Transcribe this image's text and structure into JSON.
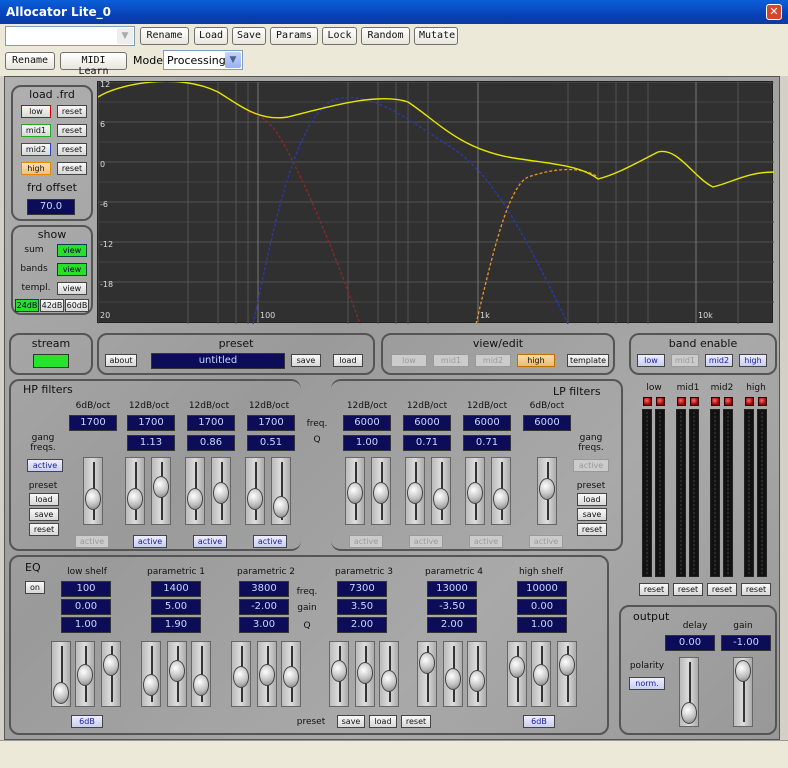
{
  "window": {
    "title": "Allocator Lite_0",
    "close_icon": "close-icon"
  },
  "toolbar": {
    "preset_combo_value": "",
    "row1_buttons": [
      "Rename",
      "Load",
      "Save",
      "Params",
      "Lock",
      "Random",
      "Mutate"
    ],
    "row2_rename": "Rename",
    "row2_midi": "MIDI Learn",
    "mode_label": "Mode",
    "mode_value": "Processing"
  },
  "load_frd": {
    "title": "load .frd",
    "bands": [
      "low",
      "mid1",
      "mid2",
      "high"
    ],
    "reset": "reset",
    "offset_label": "frd offset",
    "offset_value": "70.0"
  },
  "show": {
    "title": "show",
    "rows": [
      {
        "label": "sum",
        "btn": "view"
      },
      {
        "label": "bands",
        "btn": "view"
      },
      {
        "label": "templ.",
        "btn": "view"
      }
    ],
    "ranges": [
      "24dB",
      "42dB",
      "60dB"
    ]
  },
  "graph": {
    "y_ticks": [
      "12",
      "6",
      "0",
      "-6",
      "-12",
      "-18"
    ],
    "x_ticks": [
      "20",
      "100",
      "1k",
      "10k"
    ]
  },
  "stream": {
    "title": "stream"
  },
  "preset": {
    "title": "preset",
    "about": "about",
    "name": "untitled",
    "save": "save",
    "load": "load"
  },
  "view_edit": {
    "title": "view/edit",
    "bands": [
      "low",
      "mid1",
      "mid2",
      "high"
    ],
    "template": "template"
  },
  "band_enable": {
    "title": "band enable",
    "bands": [
      "low",
      "mid1",
      "mid2",
      "high"
    ]
  },
  "hp": {
    "title": "HP filters",
    "slopes": [
      "6dB/oct",
      "12dB/oct",
      "12dB/oct",
      "12dB/oct"
    ],
    "freqs": [
      "1700",
      "1700",
      "1700",
      "1700"
    ],
    "qs": [
      "1.13",
      "0.86",
      "0.51"
    ],
    "active": "active",
    "gang": "gang freqs.",
    "preset": "preset",
    "load": "load",
    "save": "save",
    "reset": "reset"
  },
  "lp": {
    "title": "LP filters",
    "slopes": [
      "12dB/oct",
      "12dB/oct",
      "12dB/oct",
      "6dB/oct"
    ],
    "freqs": [
      "6000",
      "6000",
      "6000",
      "6000"
    ],
    "qs": [
      "1.00",
      "0.71",
      "0.71"
    ],
    "active": "active",
    "gang": "gang freqs.",
    "preset": "preset",
    "load": "load",
    "save": "save",
    "reset": "reset"
  },
  "mid_labels": {
    "freq": "freq.",
    "q": "Q",
    "gain": "gain"
  },
  "meters": {
    "labels": [
      "low",
      "mid1",
      "mid2",
      "high"
    ],
    "reset": "reset"
  },
  "eq": {
    "title": "EQ",
    "on": "on",
    "bands": [
      {
        "name": "low shelf",
        "freq": "100",
        "gain": "0.00",
        "q": "1.00"
      },
      {
        "name": "parametric 1",
        "freq": "1400",
        "gain": "5.00",
        "q": "1.90"
      },
      {
        "name": "parametric 2",
        "freq": "3800",
        "gain": "-2.00",
        "q": "3.00"
      },
      {
        "name": "parametric 3",
        "freq": "7300",
        "gain": "3.50",
        "q": "2.00"
      },
      {
        "name": "parametric 4",
        "freq": "13000",
        "gain": "-3.50",
        "q": "2.00"
      },
      {
        "name": "high shelf",
        "freq": "10000",
        "gain": "0.00",
        "q": "1.00"
      }
    ],
    "left_db": "6dB",
    "right_db": "6dB",
    "preset": "preset",
    "save": "save",
    "load": "load",
    "reset": "reset"
  },
  "output": {
    "title": "output",
    "delay_label": "delay",
    "gain_label": "gain",
    "delay": "0.00",
    "gain": "-1.00",
    "polarity_label": "polarity",
    "polarity": "norm."
  }
}
